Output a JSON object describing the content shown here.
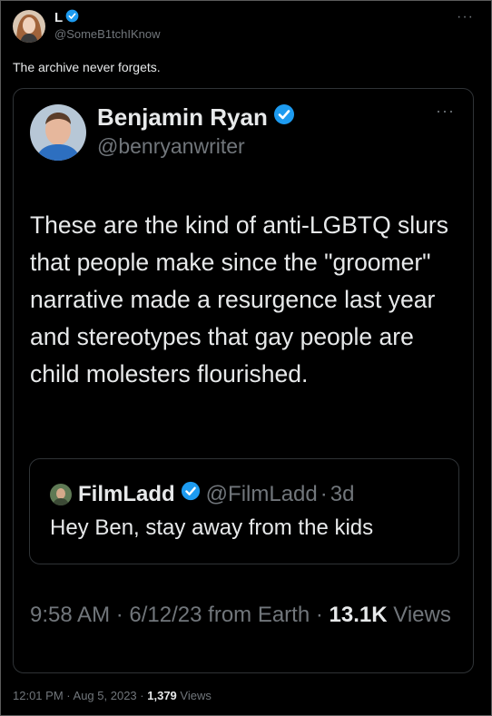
{
  "outer_tweet": {
    "display_name": "L",
    "handle": "@SomeB1tchIKnow",
    "text": "The archive never forgets.",
    "time": "12:01 PM",
    "separator": "·",
    "date": "Aug 5, 2023",
    "views_count": "1,379",
    "views_label": "Views",
    "more_glyph": "···"
  },
  "quoted_tweet": {
    "display_name": "Benjamin Ryan",
    "handle": "@benryanwriter",
    "body": "These are the kind of anti-LGBTQ slurs that people make since the \"groomer\" narrative made a resurgence last year and stereotypes that gay people are child molesters flourished.",
    "time": "9:58 AM",
    "separator": "·",
    "date": "6/12/23",
    "source": "from Earth",
    "views_count": "13.1K",
    "views_label": "Views",
    "more_glyph": "···"
  },
  "nested_quote": {
    "display_name": "FilmLadd",
    "handle": "@FilmLadd",
    "separator": "·",
    "age": "3d",
    "text": "Hey Ben, stay away from the kids"
  },
  "colors": {
    "background": "#000000",
    "text_primary": "#e7e9ea",
    "text_secondary": "#71767b",
    "verified_blue": "#1d9bf0",
    "card_border": "#2f3336"
  },
  "icons": {
    "verified": "verified-badge-icon",
    "more": "more-options-icon"
  }
}
